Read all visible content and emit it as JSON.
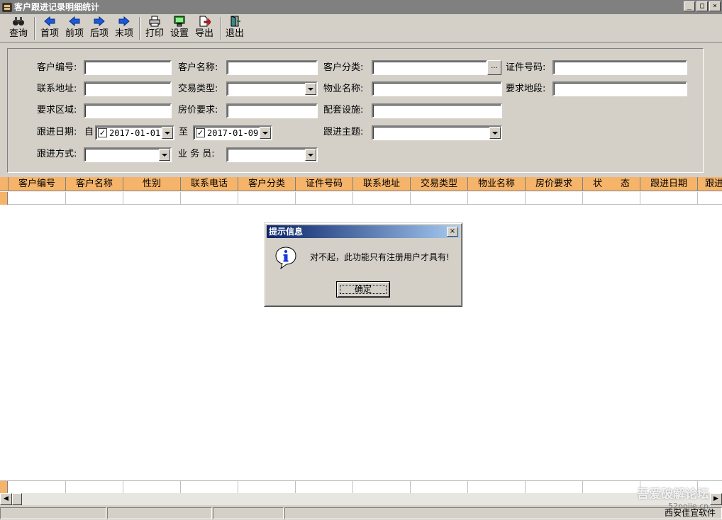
{
  "window": {
    "title": "客户跟进记录明细统计",
    "min": "_",
    "max": "□",
    "close": "×"
  },
  "toolbar": {
    "query": "查询",
    "first": "首项",
    "prev": "前项",
    "next": "后项",
    "last": "末项",
    "print": "打印",
    "settings": "设置",
    "export": "导出",
    "exit": "退出"
  },
  "form": {
    "customer_no": {
      "label": "客户编号:",
      "value": ""
    },
    "customer_name": {
      "label": "客户名称:",
      "value": ""
    },
    "customer_category": {
      "label": "客户分类:",
      "value": "",
      "btn": "..."
    },
    "id_number": {
      "label": "证件号码:",
      "value": ""
    },
    "address": {
      "label": "联系地址:",
      "value": ""
    },
    "trade_type": {
      "label": "交易类型:",
      "value": ""
    },
    "property_name": {
      "label": "物业名称:",
      "value": ""
    },
    "required_section": {
      "label": "要求地段:",
      "value": ""
    },
    "required_area": {
      "label": "要求区域:",
      "value": ""
    },
    "price_req": {
      "label": "房价要求:",
      "value": ""
    },
    "facilities": {
      "label": "配套设施:",
      "value": ""
    },
    "follow_date": {
      "label": "跟进日期:",
      "from_label": "自",
      "from": "2017-01-01",
      "to_label": "至",
      "to": "2017-01-09",
      "checked": "✓"
    },
    "follow_topic": {
      "label": "跟进主题:",
      "value": ""
    },
    "follow_method": {
      "label": "跟进方式:",
      "value": ""
    },
    "salesperson": {
      "label": "业 务 员:",
      "value": ""
    }
  },
  "grid": {
    "columns": [
      "客户编号",
      "客户名称",
      "性别",
      "联系电话",
      "客户分类",
      "证件号码",
      "联系地址",
      "交易类型",
      "物业名称",
      "房价要求",
      "状　　态",
      "跟进日期",
      "跟进"
    ]
  },
  "statusbar": {
    "right": "西安佳宜软件"
  },
  "dialog": {
    "title": "提示信息",
    "close": "×",
    "message": "对不起，此功能只有注册用户才具有!",
    "ok": "确定"
  },
  "watermark": {
    "text": "吾爱破解论坛",
    "url": "52pojie.cn"
  },
  "colors": {
    "grid_header": "#f6b46a",
    "title_bar": "#808080",
    "dialog_title": "#0a246a"
  }
}
